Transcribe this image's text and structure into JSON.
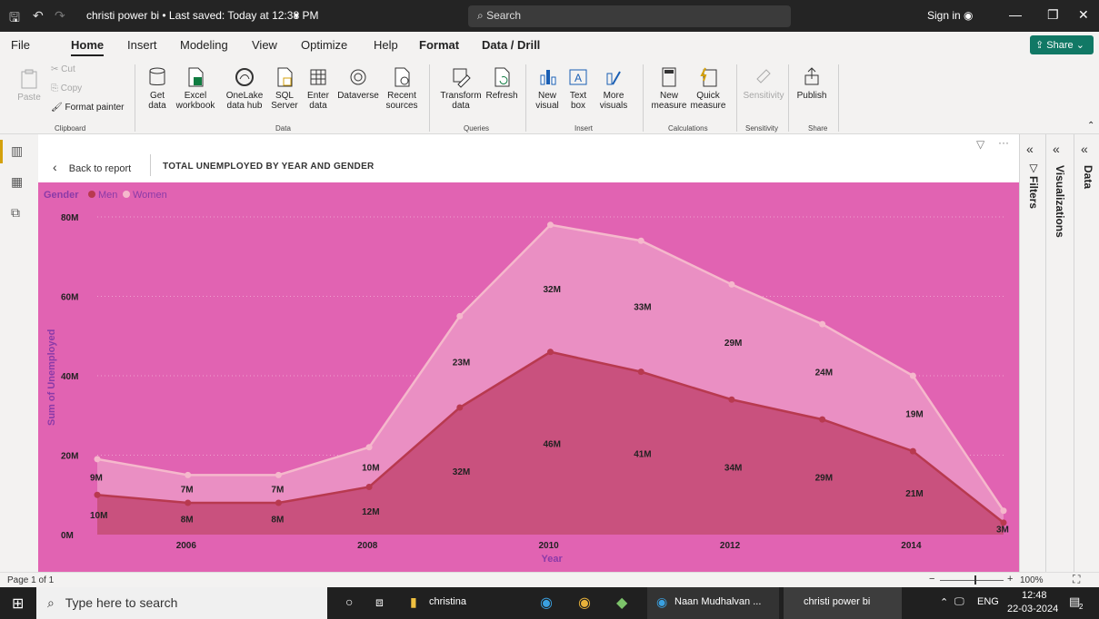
{
  "titlebar": {
    "title": "christi power bi • Last saved: Today at 12:38 PM",
    "search_placeholder": "Search",
    "signin": "Sign in"
  },
  "menu": {
    "tabs": [
      "File",
      "Home",
      "Insert",
      "Modeling",
      "View",
      "Optimize",
      "Help",
      "Format",
      "Data / Drill"
    ],
    "share": "Share"
  },
  "ribbon": {
    "clipboard": {
      "paste": "Paste",
      "cut": "Cut",
      "copy": "Copy",
      "format_painter": "Format painter",
      "group": "Clipboard"
    },
    "data": {
      "get": "Get data",
      "excel": "Excel workbook",
      "onelake": "OneLake data hub",
      "sql": "SQL Server",
      "enter": "Enter data",
      "dataverse": "Dataverse",
      "recent": "Recent sources",
      "group": "Data"
    },
    "queries": {
      "transform": "Transform data",
      "refresh": "Refresh",
      "group": "Queries"
    },
    "insert": {
      "new_visual": "New visual",
      "text_box": "Text box",
      "more_visuals": "More visuals",
      "group": "Insert"
    },
    "calculations": {
      "new_measure": "New measure",
      "quick_measure": "Quick measure",
      "group": "Calculations"
    },
    "sensitivity": {
      "label": "Sensitivity",
      "group": "Sensitivity"
    },
    "share": {
      "publish": "Publish",
      "group": "Share"
    }
  },
  "report": {
    "back": "Back to report",
    "title": "TOTAL UNEMPLOYED BY YEAR AND GENDER"
  },
  "panes": {
    "filters": "Filters",
    "visualizations": "Visualizations",
    "data": "Data"
  },
  "status": {
    "page": "Page 1 of 1",
    "zoom": "100%"
  },
  "taskbar": {
    "search": "Type here to search",
    "items": [
      "christina",
      "Naan Mudhalvan ...",
      "christi power bi"
    ],
    "lang": "ENG",
    "time": "12:48",
    "date": "22-03-2024",
    "notif": "2"
  },
  "colors": {
    "background": "#e163b2",
    "men": "#b8394f",
    "women": "#f5b8cc"
  },
  "chart_data": {
    "type": "area",
    "title": "",
    "legend_title": "Gender",
    "xlabel": "Year",
    "ylabel": "Sum of Unemployed",
    "x": [
      2005,
      2006,
      2007,
      2008,
      2009,
      2010,
      2011,
      2012,
      2013,
      2014,
      2015
    ],
    "x_tick_labels": [
      "2006",
      "2008",
      "2010",
      "2012",
      "2014"
    ],
    "y_tick_labels": [
      "0M",
      "20M",
      "40M",
      "60M",
      "80M"
    ],
    "ylim": [
      0,
      80
    ],
    "stacked": true,
    "series": [
      {
        "name": "Men",
        "values": [
          10,
          8,
          8,
          12,
          32,
          46,
          41,
          34,
          29,
          21,
          3
        ],
        "labels": [
          "10M",
          "8M",
          "8M",
          "12M",
          "32M",
          "46M",
          "41M",
          "34M",
          "29M",
          "21M",
          "3M"
        ]
      },
      {
        "name": "Women",
        "values": [
          9,
          7,
          7,
          10,
          23,
          32,
          33,
          29,
          24,
          19,
          3
        ],
        "labels": [
          "9M",
          "7M",
          "7M",
          "10M",
          "23M",
          "32M",
          "33M",
          "29M",
          "24M",
          "19M",
          ""
        ]
      }
    ],
    "legend_position": "top-left",
    "grid": true
  }
}
